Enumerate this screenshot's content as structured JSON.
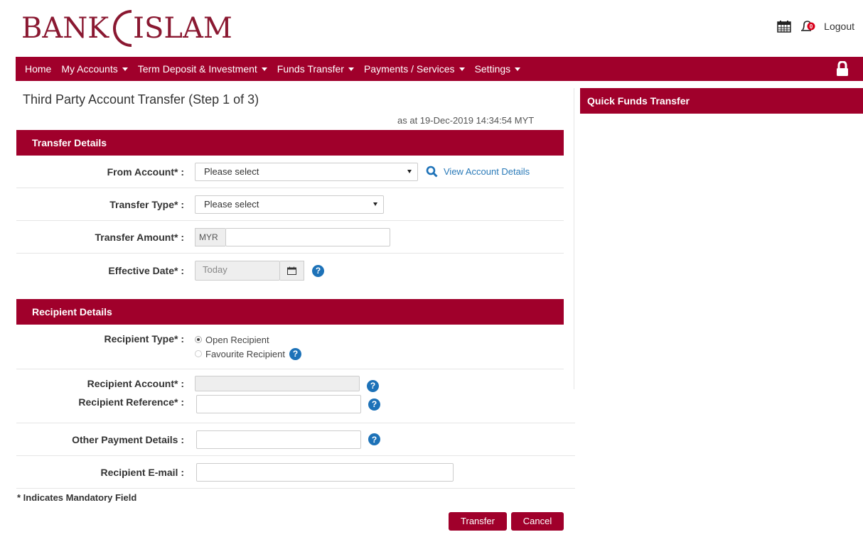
{
  "brand": {
    "left": "BANK",
    "right": "ISLAM"
  },
  "header": {
    "logout_label": "Logout",
    "calendar_icon": "calendar-icon",
    "notification_icon": "bell-icon",
    "notification_count": "0"
  },
  "nav": {
    "items": [
      {
        "label": "Home",
        "dropdown": false
      },
      {
        "label": "My Accounts",
        "dropdown": true
      },
      {
        "label": "Term Deposit & Investment",
        "dropdown": true
      },
      {
        "label": "Funds Transfer",
        "dropdown": true
      },
      {
        "label": "Payments / Services",
        "dropdown": true
      },
      {
        "label": "Settings",
        "dropdown": true
      }
    ],
    "lock_icon": "lock-icon"
  },
  "page": {
    "title": "Third Party Account Transfer (Step 1 of 3)",
    "as_at": "as at 19-Dec-2019 14:34:54 MYT"
  },
  "transfer_details": {
    "heading": "Transfer Details",
    "from_account_label": "From Account* :",
    "from_account_value": "Please select",
    "view_account_details": "View Account Details",
    "transfer_type_label": "Transfer Type* :",
    "transfer_type_value": "Please select",
    "transfer_amount_label": "Transfer Amount* :",
    "currency": "MYR",
    "effective_date_label": "Effective Date* :",
    "effective_date_value": "Today"
  },
  "recipient_details": {
    "heading": "Recipient Details",
    "recipient_type_label": "Recipient Type* :",
    "option_open": "Open Recipient",
    "option_favourite": "Favourite Recipient",
    "recipient_account_label": "Recipient Account* :",
    "recipient_reference_label": "Recipient Reference* :",
    "other_payment_label": "Other Payment Details :",
    "recipient_email_label": "Recipient E-mail :"
  },
  "footer": {
    "mandatory_note": "* Indicates Mandatory Field",
    "transfer_button": "Transfer",
    "cancel_button": "Cancel"
  },
  "sidebar": {
    "quick_title": "Quick Funds Transfer"
  },
  "colors": {
    "brand": "#a0002b",
    "logo": "#8a1831",
    "help": "#1d72b8",
    "link": "#2a7ab8"
  }
}
